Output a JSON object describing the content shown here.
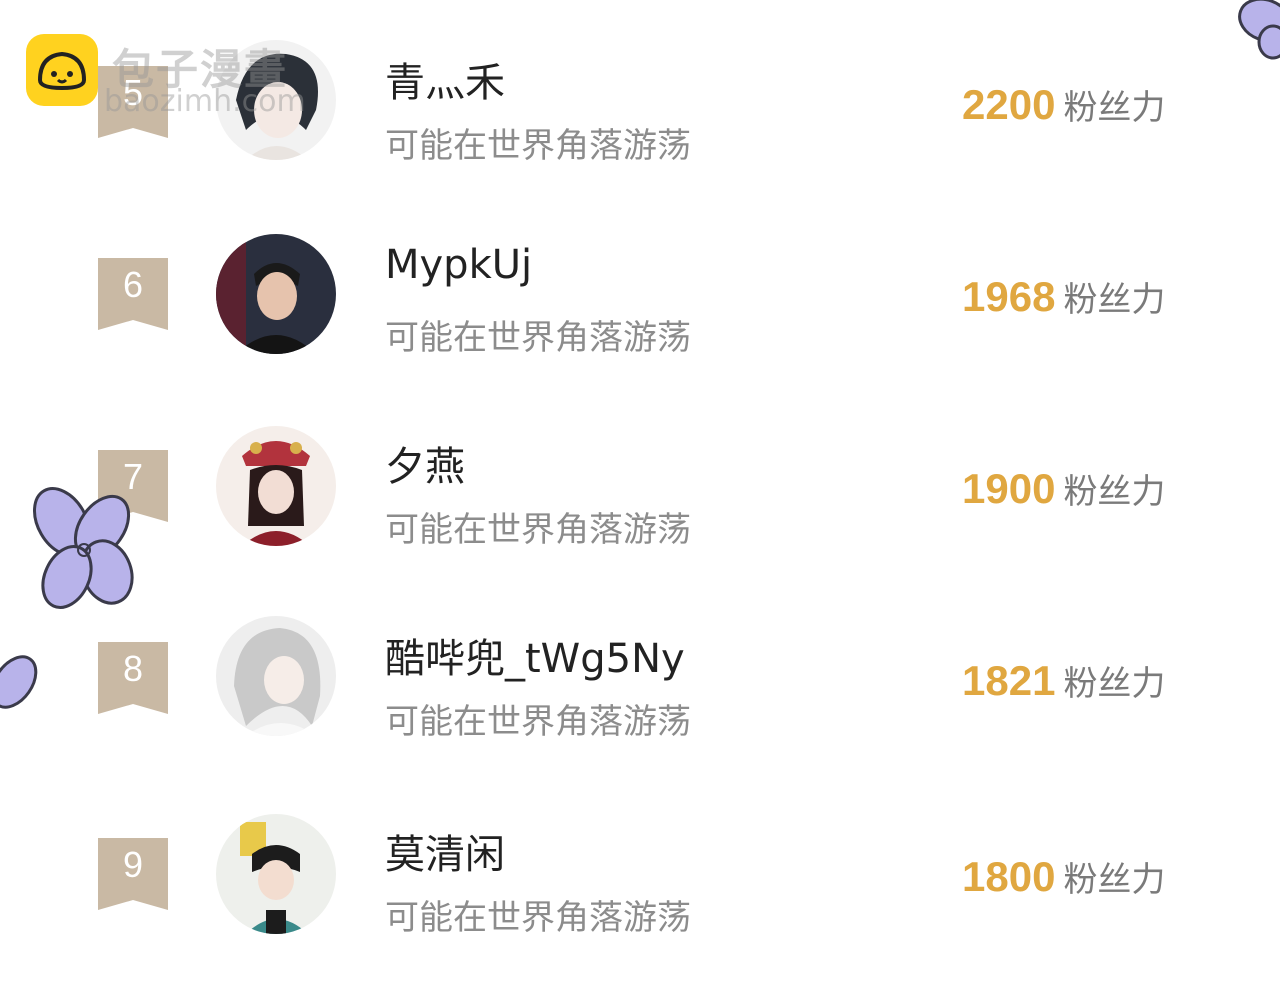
{
  "watermark": {
    "cn": "包子漫畫",
    "en": "baozimh.com"
  },
  "score_unit": "粉丝力",
  "rows": [
    {
      "rank": "5",
      "name": "青灬禾",
      "subtitle": "可能在世界角落游荡",
      "score": "2200"
    },
    {
      "rank": "6",
      "name": "MypkUj",
      "subtitle": "可能在世界角落游荡",
      "score": "1968"
    },
    {
      "rank": "7",
      "name": "夕燕",
      "subtitle": "可能在世界角落游荡",
      "score": "1900"
    },
    {
      "rank": "8",
      "name": "酷哔兜_tWg5Ny",
      "subtitle": "可能在世界角落游荡",
      "score": "1821"
    },
    {
      "rank": "9",
      "name": "莫清闲",
      "subtitle": "可能在世界角落游荡",
      "score": "1800"
    }
  ],
  "colors": {
    "badge": "#c9b9a4",
    "score": "#e0a740",
    "flower": "#b8b3ea"
  }
}
